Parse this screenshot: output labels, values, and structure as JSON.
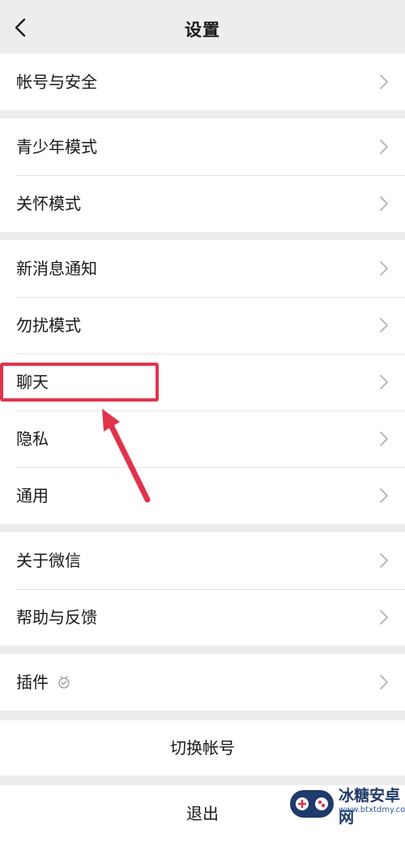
{
  "header": {
    "title": "设置",
    "back_icon": "chevron-left-icon"
  },
  "groups": [
    {
      "items": [
        {
          "label": "帐号与安全"
        }
      ]
    },
    {
      "items": [
        {
          "label": "青少年模式"
        },
        {
          "label": "关怀模式"
        }
      ]
    },
    {
      "items": [
        {
          "label": "新消息通知"
        },
        {
          "label": "勿扰模式"
        },
        {
          "label": "聊天"
        },
        {
          "label": "隐私"
        },
        {
          "label": "通用"
        }
      ]
    },
    {
      "items": [
        {
          "label": "关于微信"
        },
        {
          "label": "帮助与反馈"
        }
      ]
    },
    {
      "items": [
        {
          "label": "插件",
          "icon": "plugin-icon"
        }
      ]
    }
  ],
  "actions": {
    "switch_account": "切换帐号",
    "logout": "退出"
  },
  "annotation": {
    "color": "#e0334c",
    "highlighted_item": "聊天"
  },
  "watermark": {
    "name": "冰糖安卓网",
    "url": "www.btxtdmy.com"
  },
  "colors": {
    "background": "#ededed",
    "row": "#ffffff",
    "text": "#191919",
    "chevron": "#b2b2b2"
  }
}
